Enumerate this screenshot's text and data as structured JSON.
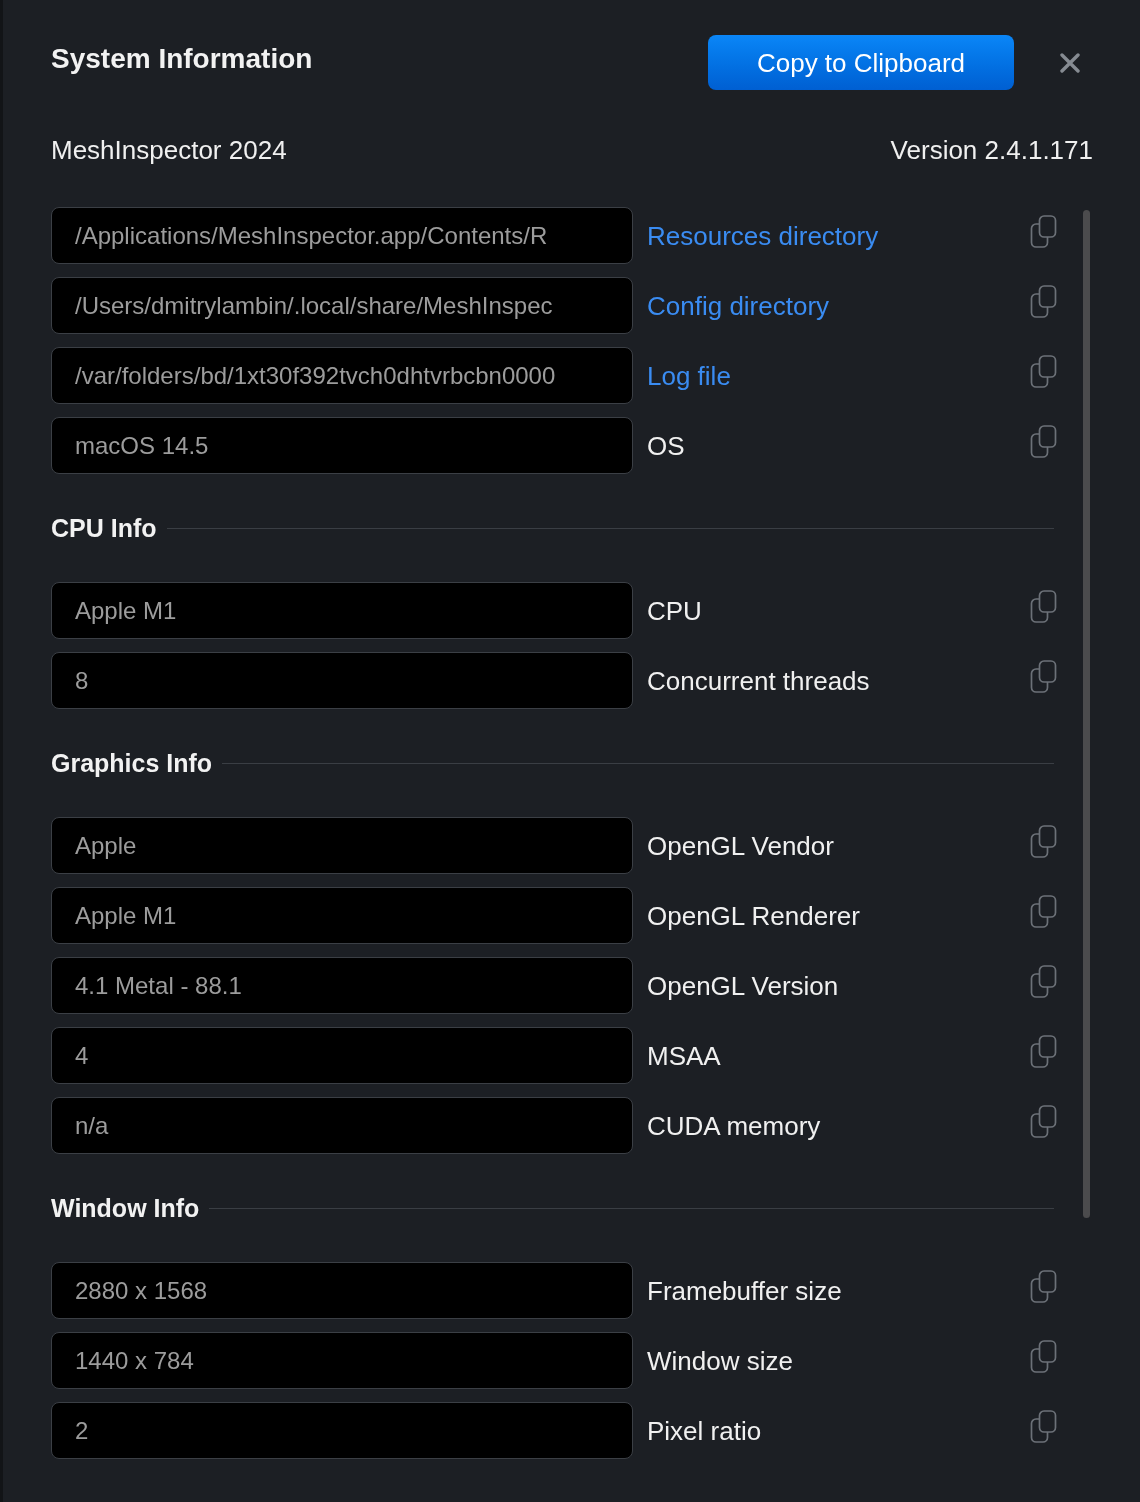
{
  "dialog": {
    "title": "System Information",
    "copy_button": "Copy to Clipboard"
  },
  "app": {
    "name": "MeshInspector 2024",
    "version": "Version 2.4.1.171"
  },
  "groups": [
    {
      "rows": [
        {
          "value": "/Applications/MeshInspector.app/Contents/R",
          "label": "Resources directory",
          "kind": "link"
        },
        {
          "value": "/Users/dmitrylambin/.local/share/MeshInspec",
          "label": "Config directory",
          "kind": "link"
        },
        {
          "value": "/var/folders/bd/1xt30f392tvch0dhtvrbcbn0000",
          "label": "Log file",
          "kind": "link"
        },
        {
          "value": "macOS 14.5",
          "label": "OS",
          "kind": "text"
        }
      ]
    },
    {
      "title": "CPU Info",
      "rows": [
        {
          "value": "Apple M1",
          "label": "CPU",
          "kind": "text"
        },
        {
          "value": "8",
          "label": "Concurrent threads",
          "kind": "text"
        }
      ]
    },
    {
      "title": "Graphics Info",
      "rows": [
        {
          "value": "Apple",
          "label": "OpenGL Vendor",
          "kind": "text"
        },
        {
          "value": "Apple M1",
          "label": "OpenGL Renderer",
          "kind": "text"
        },
        {
          "value": "4.1 Metal - 88.1",
          "label": "OpenGL Version",
          "kind": "text"
        },
        {
          "value": "4",
          "label": "MSAA",
          "kind": "text"
        },
        {
          "value": "n/a",
          "label": "CUDA memory",
          "kind": "text"
        }
      ]
    },
    {
      "title": "Window Info",
      "rows": [
        {
          "value": "2880 x 1568",
          "label": "Framebuffer size",
          "kind": "text"
        },
        {
          "value": "1440 x 784",
          "label": "Window size",
          "kind": "text"
        },
        {
          "value": "2",
          "label": "Pixel ratio",
          "kind": "text"
        }
      ]
    }
  ]
}
